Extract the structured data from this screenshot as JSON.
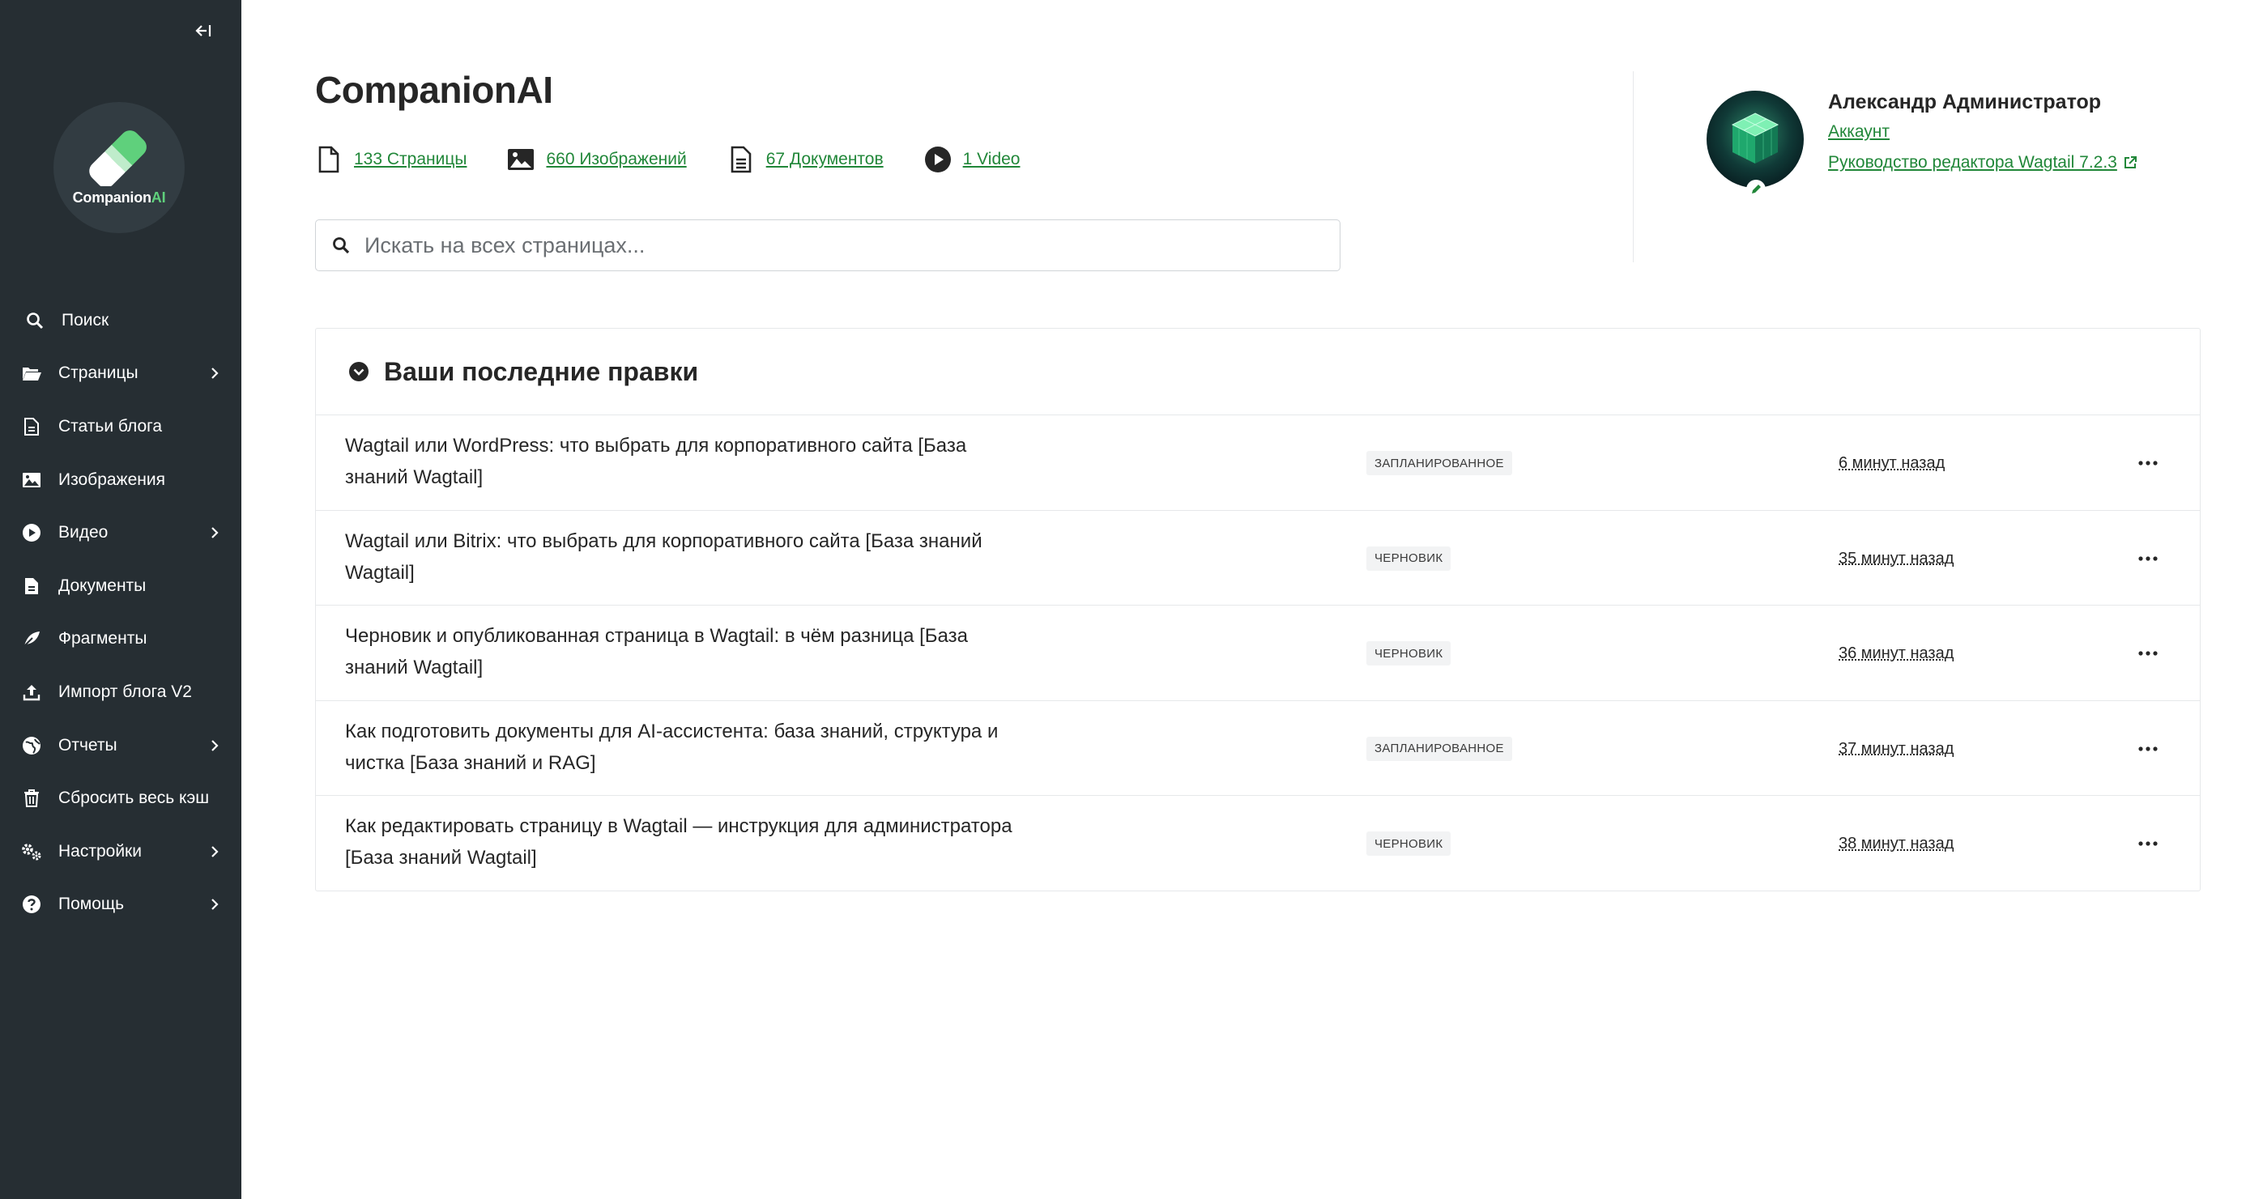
{
  "colors": {
    "sidebar_bg": "#262e33",
    "accent_green": "#218739",
    "logo_green": "#5fd07c"
  },
  "logo": {
    "brand": "Companion",
    "brand_suffix": "AI"
  },
  "sidebar": {
    "items": [
      {
        "label": "Поиск",
        "icon": "search-icon",
        "has_submenu": false
      },
      {
        "label": "Страницы",
        "icon": "folder-open-icon",
        "has_submenu": true
      },
      {
        "label": "Статьи блога",
        "icon": "document-icon",
        "has_submenu": false
      },
      {
        "label": "Изображения",
        "icon": "image-icon",
        "has_submenu": false
      },
      {
        "label": "Видео",
        "icon": "play-icon",
        "has_submenu": true
      },
      {
        "label": "Документы",
        "icon": "doc-full-icon",
        "has_submenu": false
      },
      {
        "label": "Фрагменты",
        "icon": "snippet-icon",
        "has_submenu": false
      },
      {
        "label": "Импорт блога V2",
        "icon": "upload-icon",
        "has_submenu": false
      },
      {
        "label": "Отчеты",
        "icon": "globe-icon",
        "has_submenu": true
      },
      {
        "label": "Сбросить весь кэш",
        "icon": "trash-icon",
        "has_submenu": false
      },
      {
        "label": "Настройки",
        "icon": "cogs-icon",
        "has_submenu": true
      },
      {
        "label": "Помощь",
        "icon": "help-icon",
        "has_submenu": true
      }
    ]
  },
  "header": {
    "site_title": "CompanionAI",
    "summary": [
      {
        "label": "133 Страницы",
        "icon": "page-icon"
      },
      {
        "label": "660 Изображений",
        "icon": "image-icon"
      },
      {
        "label": "67 Документов",
        "icon": "doc-icon"
      },
      {
        "label": "1 Video",
        "icon": "play-icon"
      }
    ],
    "search_placeholder": "Искать на всех страницах..."
  },
  "user": {
    "name": "Александр Администратор",
    "account_link": "Аккаунт",
    "guide_link": "Руководство редактора Wagtail 7.2.3"
  },
  "recent_edits": {
    "heading": "Ваши последние правки",
    "rows": [
      {
        "title": "Wagtail или WordPress: что выбрать для корпоративного сайта [База знаний Wagtail]",
        "status": "ЗАПЛАНИРОВАННОЕ",
        "time": "6 минут назад"
      },
      {
        "title": "Wagtail или Bitrix: что выбрать для корпоративного сайта [База знаний Wagtail]",
        "status": "ЧЕРНОВИК",
        "time": "35 минут назад"
      },
      {
        "title": "Черновик и опубликованная страница в Wagtail: в чём разница [База знаний Wagtail]",
        "status": "ЧЕРНОВИК",
        "time": "36 минут назад"
      },
      {
        "title": "Как подготовить документы для AI-ассистента: база знаний, структура и чистка [База знаний и RAG]",
        "status": "ЗАПЛАНИРОВАННОЕ",
        "time": "37 минут назад"
      },
      {
        "title": "Как редактировать страницу в Wagtail — инструкция для администратора [База знаний Wagtail]",
        "status": "ЧЕРНОВИК",
        "time": "38 минут назад"
      }
    ]
  }
}
